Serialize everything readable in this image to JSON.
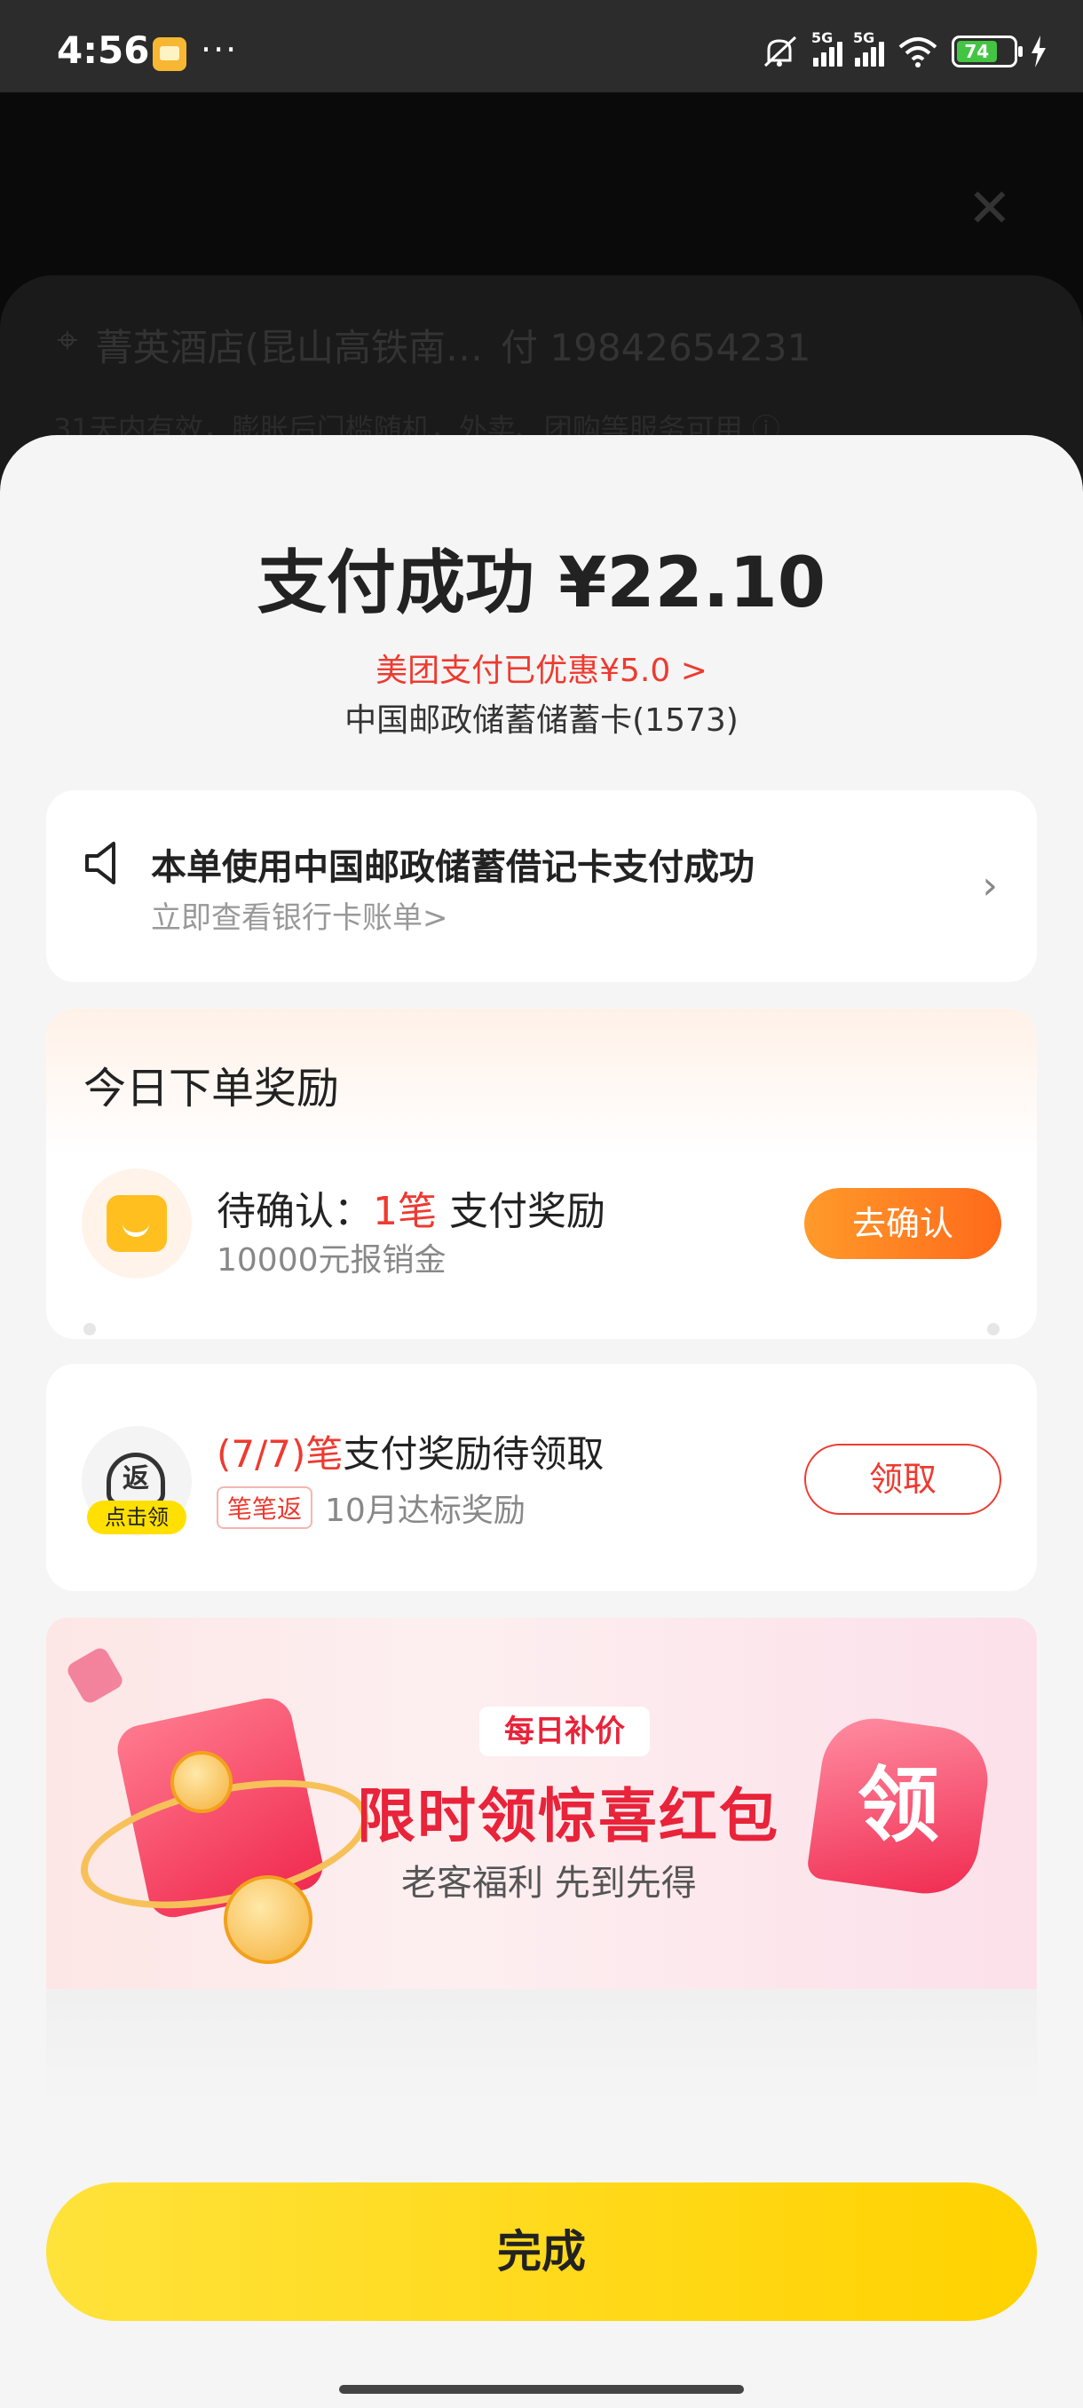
{
  "status_bar": {
    "time": "4:56",
    "more": "···",
    "signal1_label": "5G",
    "signal2_label": "5G",
    "battery_level": "74"
  },
  "background_page": {
    "location": "菁英酒店(昆山高铁南…",
    "pay_info": "付 19842654231",
    "note": "31天内有效，膨胀后门槛随机，外卖、团购等服务可用 ⓘ"
  },
  "payment": {
    "title": "支付成功 ¥22.10",
    "discount": "美团支付已优惠¥5.0 >",
    "card": "中国邮政储蓄储蓄卡(1573)"
  },
  "notice": {
    "title": "本单使用中国邮政储蓄借记卡支付成功",
    "subtitle": "立即查看银行卡账单>",
    "chevron": "›"
  },
  "rewards": {
    "heading": "今日下单奖励",
    "pending_prefix": "待确认：",
    "pending_count": "1笔",
    "pending_suffix": " 支付奖励",
    "pending_sub": "10000元报销金",
    "confirm_button": "去确认"
  },
  "claim": {
    "icon_text": "返",
    "icon_badge": "点击领",
    "count": "(7/7)笔",
    "title_rest": "支付奖励待领取",
    "tag": "笔笔返",
    "subtitle": "10月达标奖励",
    "claim_button": "领取"
  },
  "banner": {
    "tag": "每日补价",
    "title": "限时领惊喜红包",
    "subtitle": "老客福利 先到先得",
    "badge": "领"
  },
  "done_button": "完成"
}
